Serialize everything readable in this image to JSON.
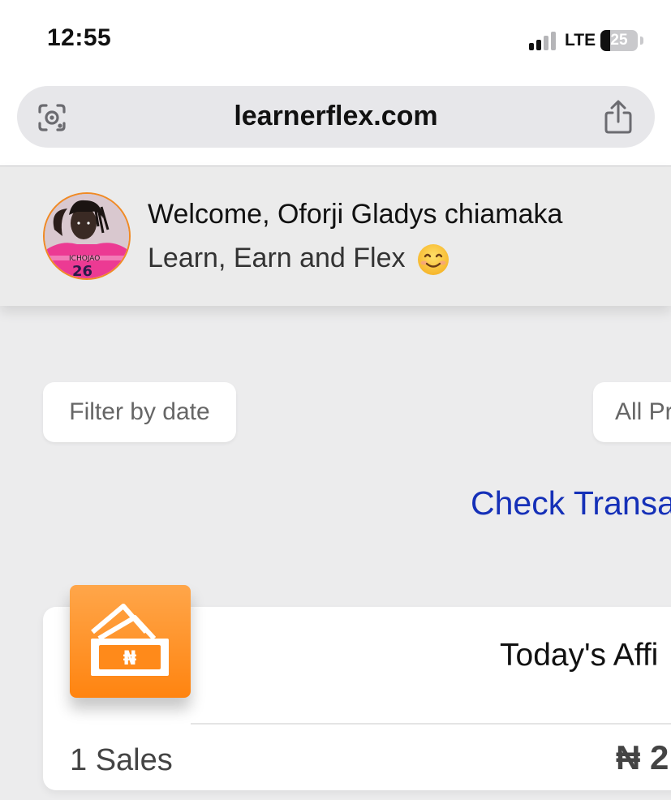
{
  "status_bar": {
    "time": "12:55",
    "network": "LTE",
    "battery": "25",
    "battery_fraction": 0.25
  },
  "browser": {
    "url": "learnerflex.com"
  },
  "header": {
    "welcome": "Welcome, Oforji Gladys chiamaka",
    "tagline": "Learn, Earn and Flex"
  },
  "filters": {
    "date_label": "Filter by date",
    "products_label": "All Pr"
  },
  "links": {
    "check_transactions": "Check Transa"
  },
  "card": {
    "title": "Today's Affi",
    "sales": "1 Sales",
    "amount": "₦ 2"
  },
  "colors": {
    "accent_orange": "#ff8410",
    "link_blue": "#1530b8",
    "avatar_ring": "#f08a24"
  },
  "icons": [
    "lens-icon",
    "share-icon",
    "smile-emoji-icon",
    "money-icon"
  ]
}
